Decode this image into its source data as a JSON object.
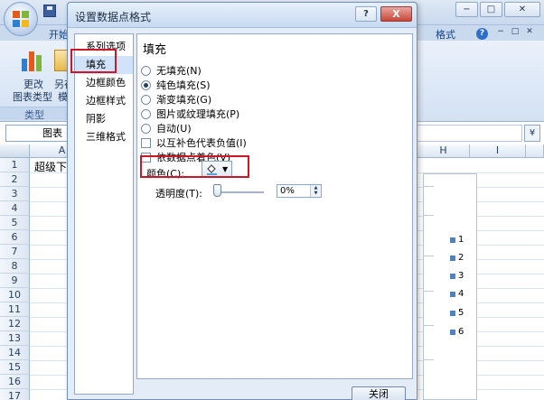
{
  "dialog": {
    "title": "设置数据点格式",
    "help_label": "?",
    "close_label": "X",
    "nav": [
      "系列选项",
      "填充",
      "边框颜色",
      "边框样式",
      "阴影",
      "三维格式"
    ],
    "selected_nav": "填充",
    "panel": {
      "title": "填充",
      "options": [
        {
          "type": "radio",
          "label": "无填充(N)",
          "checked": false
        },
        {
          "type": "radio",
          "label": "纯色填充(S)",
          "checked": true
        },
        {
          "type": "radio",
          "label": "渐变填充(G)",
          "checked": false
        },
        {
          "type": "radio",
          "label": "图片或纹理填充(P)",
          "checked": false
        },
        {
          "type": "radio",
          "label": "自动(U)",
          "checked": false
        },
        {
          "type": "checkbox",
          "label": "以互补色代表负值(I)",
          "checked": false
        },
        {
          "type": "checkbox",
          "label": "依数据点着色(V)",
          "checked": false
        }
      ],
      "color_label": "颜色(C):",
      "transparency_label": "透明度(T):",
      "transparency_value": "0%"
    },
    "close_button": "关闭"
  },
  "excel": {
    "tab_start": "开始",
    "tab_format": "格式",
    "ribbon": {
      "change_line1": "更改",
      "change_line2": "图表类型",
      "save_line1": "另存",
      "save_line2": "模",
      "group_label": "类型"
    },
    "namebox": "图表",
    "columns": [
      "A",
      "H",
      "I"
    ],
    "rows": [
      "1",
      "2",
      "3",
      "4",
      "5",
      "6",
      "7",
      "8",
      "9",
      "10",
      "11",
      "12",
      "13",
      "14",
      "15",
      "16",
      "17"
    ],
    "cell_a1": "超级下",
    "legend": [
      "1",
      "2",
      "3",
      "4",
      "5",
      "6"
    ],
    "window_controls": [
      "−",
      "□",
      "✕"
    ],
    "doc_controls": [
      "−",
      "□",
      "✕"
    ],
    "help_label": "?",
    "expand_label": "¥"
  },
  "colors": {
    "highlight": "#c8182a",
    "series": "#4f81bd",
    "fill_color": "#4aa8e0"
  }
}
